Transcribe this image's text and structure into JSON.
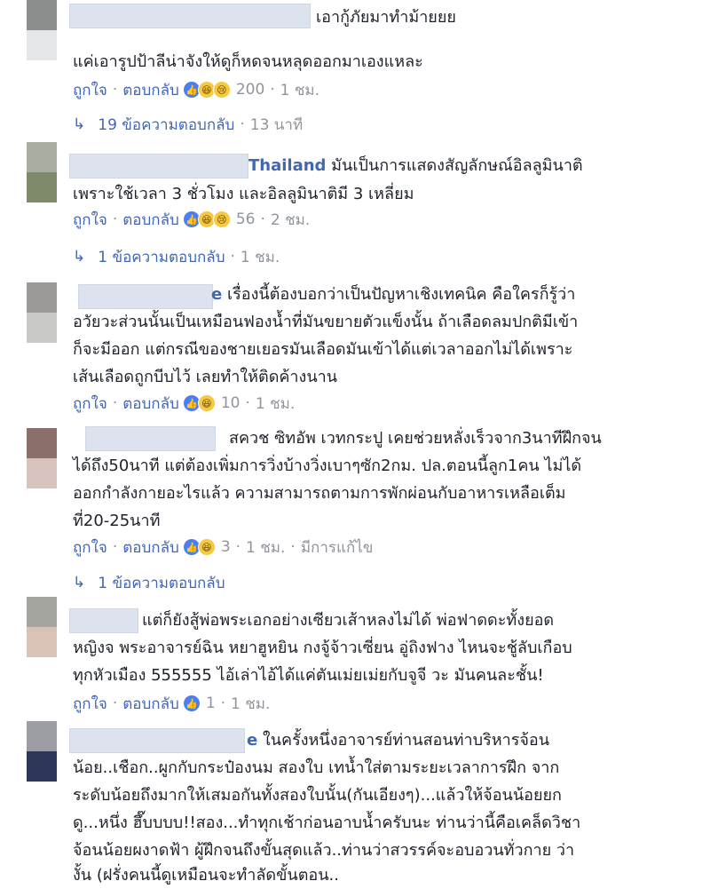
{
  "comments": [
    {
      "text_lines": [
        "เอากู้ภัยมาทำม้ายยย",
        "แค่เอารูปป้าลีน่าจังให้ดูก็หดจนหลุดออกมาเองแหละ"
      ],
      "like": "ถูกใจ",
      "reply": "ตอบกลับ",
      "reactions": [
        "like",
        "haha",
        "sad"
      ],
      "count": "200",
      "time": "1 ชม.",
      "replies": {
        "label": "19 ข้อความตอบกลับ",
        "time": "13 นาที"
      }
    },
    {
      "name_visible": "Thailand",
      "text_lines": [
        "มันเป็นการแสดงสัญลักษณ์อิลลูมินาติ",
        "เพราะใช้เวลา 3 ชั่วโมง และอิลลูมินาติมี 3 เหลี่ยม"
      ],
      "like": "ถูกใจ",
      "reply": "ตอบกลับ",
      "reactions": [
        "like",
        "haha",
        "sad"
      ],
      "count": "56",
      "time": "2 ชม.",
      "replies": {
        "label": "1 ข้อความตอบกลับ",
        "time": "1 ชม."
      }
    },
    {
      "name_visible": "e",
      "text_lines": [
        "เรื่องนี้ต้องบอกว่าเป็นปัญหาเชิงเทคนิค คือใครก็รู้ว่า",
        "อวัยวะส่วนนั้นเป็นเหมือนฟองน้ำที่มันขยายตัวแข็งนั้น ถ้าเลือดลมปกติมีเข้า",
        "ก็จะมีออก แต่กรณีของชายเยอรมันเลือดมันเข้าได้แต่เวลาออกไม่ได้เพราะ",
        "เส้นเลือดถูกบีบไว้ เลยทำให้ติดค้างนาน"
      ],
      "like": "ถูกใจ",
      "reply": "ตอบกลับ",
      "reactions": [
        "like",
        "haha"
      ],
      "count": "10",
      "time": "1 ชม."
    },
    {
      "text_lines": [
        "สควช ซิทอัพ เวทกระปู เคยช่วยหลั่งเร็วจาก3นาทีฝึกจน",
        "ได้ถึง50นาที แต่ต้องเพิ่มการวิ่งบ้างวิ่งเบาๆซัก2กม. ปล.ตอนนี้ลูก1คน ไม่ได้",
        "ออกกำลังกายอะไรแล้ว ความสามารถตามการพักผ่อนกับอาหารเหลือเต็ม",
        "ที่20-25นาที"
      ],
      "like": "ถูกใจ",
      "reply": "ตอบกลับ",
      "reactions": [
        "like",
        "haha"
      ],
      "count": "3",
      "time": "1 ชม.",
      "edited": "มีการแก้ไข",
      "replies": {
        "label": "1 ข้อความตอบกลับ",
        "time": ""
      }
    },
    {
      "text_lines": [
        "แต่ก็ยังสู้พ่อพระเอกอย่างเซียวเส้าหลงไม่ได้ พ่อฟาดดะทั้งยอด",
        "หญิงจ พระอาจารย์ฉิน หยาฮูหยิน กงจู้จ้าวเซี่ยน อู่ถิงฟาง ไหนจะชู้ลับเกือบ",
        "ทุกหัวเมือง 555555 ไอ้เล่าไอ้ได้แค่ตันเม่ยเม่ยกับจูจี วะ มันคนละชั้น!"
      ],
      "like": "ถูกใจ",
      "reply": "ตอบกลับ",
      "reactions": [
        "like"
      ],
      "count": "1",
      "time": "1 ชม."
    },
    {
      "name_visible": "e",
      "text_lines": [
        "ในครั้งหนึ่งอาจารย์ท่านสอนท่าบริหารจ้อน",
        "น้อย..เชือก..ผูกกับกระป๋องนม สองใบ เทน้ำใส่ตามระยะเวลาการฝึก จาก",
        "ระดับน้อยถึงมากให้เสมอกันทั้งสองใบนั้น(กันเอียงๆ)...แล้วให้จ้อนน้อยยก",
        "ดู...หนึ่ง ฮึ๊บบบบ!!สอง...ทำทุกเช้าก่อนอาบน้ำครับนะ ท่านว่านี้คือเคล็ดวิชา",
        "จ้อนน้อยผงาดฟ้า ผู้ฝึกจนถึงขั้นสุดแล้ว..ท่านว่าสวรรค์จะอบอวนทั่วกาย ว่า",
        "งั้น (ฝรั่งคนนี้ดูเหมือนจะทำลัดขั้นตอน.."
      ]
    }
  ],
  "colors": {
    "link": "#4267b2",
    "meta": "#90949c",
    "text": "#1d2129"
  }
}
